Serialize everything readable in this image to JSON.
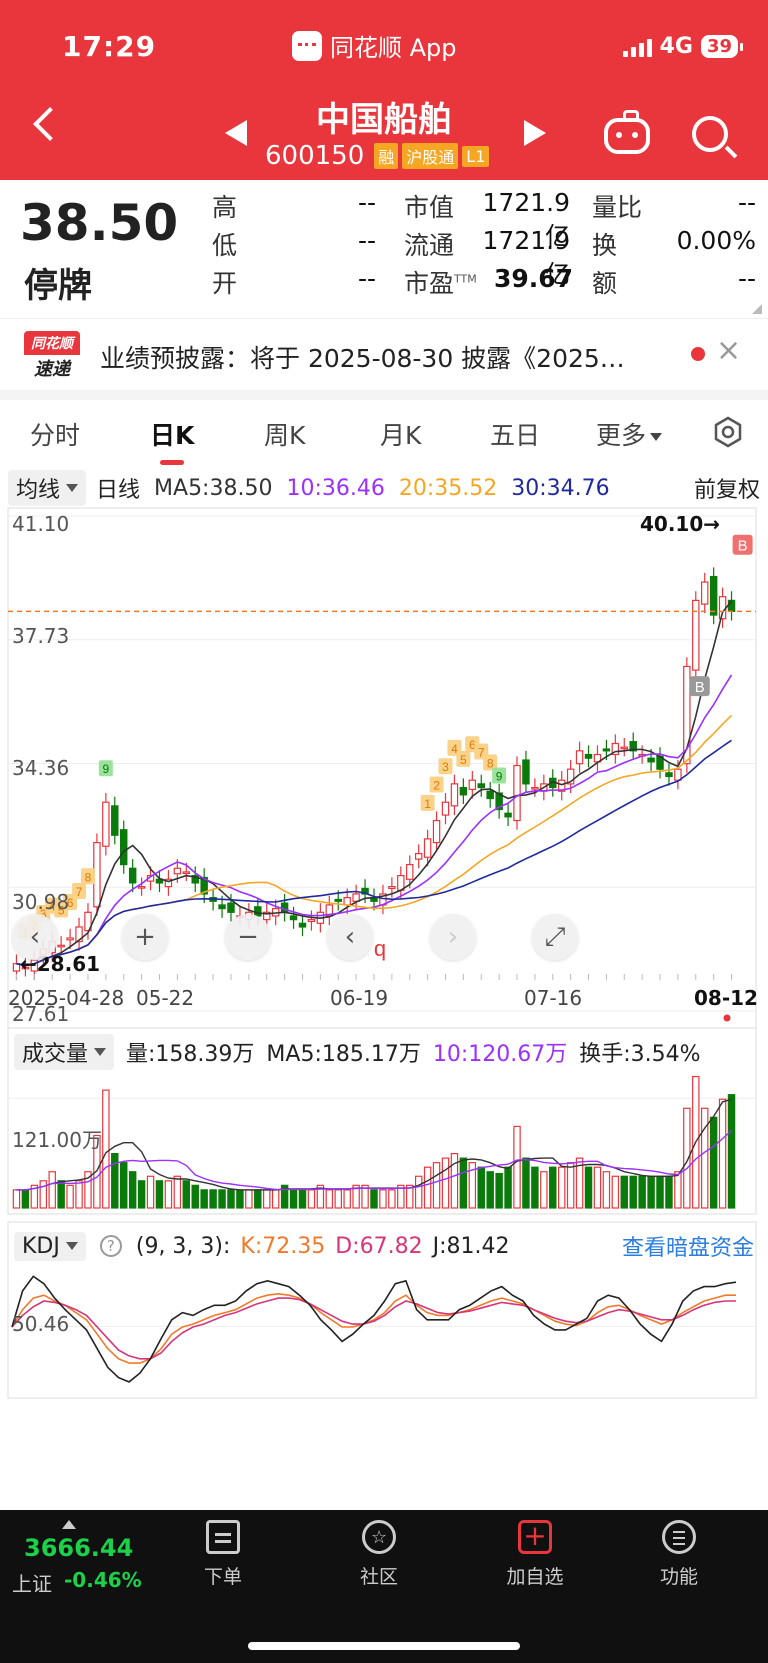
{
  "status_bar": {
    "time": "17:29",
    "app": "同花顺 App",
    "network": "4G",
    "battery": "39"
  },
  "header": {
    "name": "中国船舶",
    "code": "600150",
    "tags": [
      "融",
      "沪股通",
      "L1"
    ]
  },
  "quote": {
    "price": "38.50",
    "status": "停牌",
    "high_label": "高",
    "high": "--",
    "low_label": "低",
    "low": "--",
    "open_label": "开",
    "open": "--",
    "mktcap_label": "市值",
    "mktcap": "1721.9亿",
    "float_label": "流通",
    "float": "1721.9亿",
    "pe_label": "市盈",
    "pe_sup": "TTM",
    "pe": "39.67",
    "vol_ratio_label": "量比",
    "vol_ratio": "--",
    "turnover_label": "换",
    "turnover": "0.00%",
    "amount_label": "额",
    "amount": "--"
  },
  "news": {
    "logo_top": "同花顺",
    "logo_bottom": "速递",
    "text": "业绩预披露：将于 2025-08-30 披露《2025…"
  },
  "tabs": [
    "分时",
    "日K",
    "周K",
    "月K",
    "五日",
    "更多"
  ],
  "ma_bar": {
    "dropdown": "均线",
    "period": "日线",
    "ma5": "MA5:38.50",
    "ma10": "10:36.46",
    "ma20": "20:35.52",
    "ma30": "30:34.76",
    "adjust": "前复权"
  },
  "colors": {
    "up": "#e8363c",
    "down": "#0a7a0a",
    "ma5": "#333333",
    "ma10": "#9b30ff",
    "ma20": "#f5a623",
    "ma30": "#1f2a9e",
    "kdj_k": "#f07a2a",
    "kdj_d": "#d6357a",
    "kdj_j": "#222222"
  },
  "kline": {
    "y_labels": [
      "41.10",
      "37.73",
      "34.36",
      "30.98",
      "27.61"
    ],
    "high_mark": "40.10→",
    "low_mark": "←28.61",
    "x_labels": [
      "2025-04-28",
      "05-22",
      "06-19",
      "07-16",
      "08-12"
    ],
    "badges": [
      "B",
      "B"
    ],
    "seq_red": [
      "1",
      "2",
      "3",
      "4",
      "5",
      "6",
      "7",
      "8",
      "1",
      "2",
      "3",
      "4",
      "5",
      "6",
      "7",
      "8"
    ],
    "seq_green": [
      "9",
      "9"
    ]
  },
  "chart_data": [
    {
      "type": "candlestick",
      "title": "日K",
      "x_range": [
        "2025-04-28",
        "2025-08-12"
      ],
      "ylim": [
        27.61,
        41.1
      ],
      "last_close": 38.5,
      "high": 40.1,
      "low": 28.61,
      "closes": [
        28.9,
        28.8,
        29.0,
        29.3,
        29.5,
        29.4,
        29.6,
        29.9,
        30.3,
        32.2,
        33.3,
        32.4,
        31.6,
        31.1,
        31.0,
        31.3,
        31.1,
        31.2,
        31.5,
        31.4,
        31.1,
        30.8,
        30.6,
        30.4,
        30.3,
        30.2,
        30.3,
        30.2,
        30.3,
        30.4,
        30.3,
        30.1,
        29.9,
        30.1,
        30.3,
        30.5,
        30.6,
        30.7,
        30.8,
        30.8,
        30.6,
        30.8,
        31.0,
        31.3,
        31.6,
        31.9,
        32.3,
        32.8,
        33.3,
        33.8,
        33.5,
        33.9,
        33.7,
        33.4,
        33.1,
        32.9,
        34.3,
        33.8,
        33.7,
        33.8,
        33.7,
        33.9,
        34.2,
        34.7,
        34.5,
        34.6,
        34.7,
        34.9,
        34.8,
        34.7,
        34.6,
        34.4,
        34.2,
        34.0,
        34.2,
        37.0,
        38.8,
        39.3,
        38.4,
        38.9,
        38.5
      ],
      "ma": {
        "MA5": 38.5,
        "MA10": 36.46,
        "MA20": 35.52,
        "MA30": 34.76
      }
    },
    {
      "type": "bar",
      "title": "成交量",
      "current": "158.39万",
      "ma5": "185.17万",
      "ma10": "120.67万",
      "turnover": "3.54%",
      "y_label": "121.00万",
      "values": [
        20,
        20,
        25,
        30,
        40,
        30,
        25,
        30,
        40,
        80,
        130,
        60,
        50,
        40,
        30,
        35,
        30,
        30,
        35,
        30,
        25,
        20,
        20,
        20,
        20,
        20,
        20,
        20,
        20,
        20,
        25,
        20,
        20,
        20,
        25,
        20,
        20,
        20,
        25,
        25,
        20,
        20,
        20,
        25,
        25,
        35,
        45,
        50,
        55,
        60,
        55,
        50,
        45,
        40,
        38,
        45,
        90,
        55,
        45,
        40,
        45,
        45,
        50,
        55,
        45,
        45,
        40,
        35,
        35,
        35,
        35,
        35,
        35,
        35,
        40,
        110,
        145,
        110,
        100,
        120,
        125
      ]
    },
    {
      "type": "line",
      "title": "KDJ",
      "params": "(9, 3, 3)",
      "K": 72.35,
      "D": 67.82,
      "J": 81.42,
      "y_label": "50.46",
      "series": [
        {
          "name": "K",
          "values": [
            50,
            62,
            70,
            72,
            68,
            65,
            60,
            55,
            45,
            35,
            28,
            25,
            25,
            28,
            35,
            45,
            50,
            52,
            55,
            58,
            60,
            62,
            66,
            70,
            72,
            73,
            72,
            70,
            66,
            60,
            55,
            50,
            50,
            52,
            55,
            60,
            68,
            72,
            65,
            60,
            58,
            58,
            60,
            62,
            65,
            68,
            70,
            68,
            66,
            62,
            58,
            54,
            52,
            51,
            54,
            60,
            64,
            65,
            62,
            58,
            55,
            52,
            55,
            60,
            64,
            68,
            70,
            72,
            72
          ]
        },
        {
          "name": "D",
          "values": [
            50,
            58,
            64,
            68,
            67,
            65,
            62,
            58,
            50,
            42,
            34,
            30,
            28,
            28,
            32,
            40,
            46,
            50,
            52,
            55,
            58,
            60,
            63,
            66,
            68,
            70,
            70,
            69,
            66,
            62,
            58,
            54,
            52,
            52,
            54,
            58,
            64,
            68,
            66,
            63,
            60,
            59,
            60,
            61,
            63,
            65,
            67,
            66,
            65,
            62,
            59,
            56,
            54,
            53,
            54,
            57,
            60,
            62,
            61,
            59,
            57,
            55,
            55,
            58,
            62,
            65,
            67,
            68,
            68
          ]
        },
        {
          "name": "J",
          "values": [
            50,
            75,
            85,
            80,
            70,
            62,
            55,
            48,
            35,
            22,
            15,
            12,
            18,
            28,
            42,
            55,
            60,
            58,
            62,
            65,
            65,
            68,
            75,
            80,
            82,
            80,
            78,
            72,
            65,
            55,
            48,
            40,
            45,
            52,
            58,
            68,
            80,
            82,
            62,
            55,
            55,
            55,
            62,
            65,
            70,
            75,
            78,
            72,
            68,
            58,
            52,
            48,
            48,
            52,
            56,
            68,
            72,
            70,
            62,
            52,
            45,
            40,
            52,
            68,
            75,
            78,
            78,
            80,
            81
          ]
        }
      ]
    }
  ],
  "volume_bar": {
    "dropdown": "成交量",
    "vol": "量:158.39万",
    "ma5": "MA5:185.17万",
    "ma10": "10:120.67万",
    "turnover": "换手:3.54%"
  },
  "kdj_bar": {
    "dropdown": "KDJ",
    "help": "?",
    "params": "(9, 3, 3):",
    "k": "K:72.35",
    "d": "D:67.82",
    "j": "J:81.42",
    "link": "查看暗盘资金"
  },
  "float_buttons": {
    "prev": "‹",
    "zoom_in": "+",
    "zoom_out": "−",
    "page_prev": "‹",
    "page_next": "›",
    "fullscreen": "⤢"
  },
  "bottom_bar": {
    "index_value": "3666.44",
    "index_name": "上证",
    "index_change": "-0.46%",
    "items": [
      {
        "label": "下单",
        "icon": "order-icon"
      },
      {
        "label": "社区",
        "icon": "community-icon"
      },
      {
        "label": "加自选",
        "icon": "add-watch-icon"
      },
      {
        "label": "功能",
        "icon": "menu-icon"
      }
    ]
  }
}
